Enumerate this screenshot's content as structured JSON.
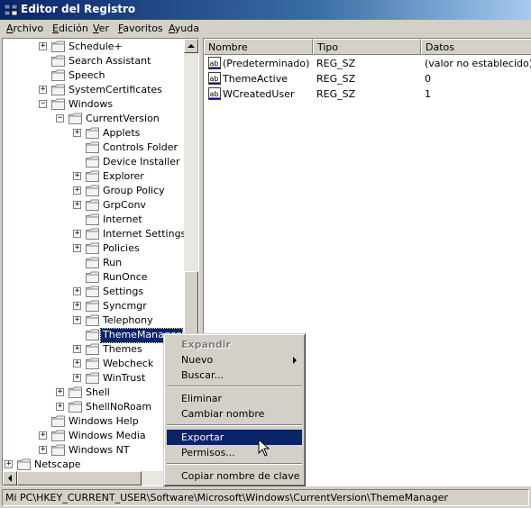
{
  "window": {
    "title": "Editor del Registro"
  },
  "menu": [
    "Archivo",
    "Edición",
    "Ver",
    "Favoritos",
    "Ayuda"
  ],
  "tree": [
    {
      "label": "Schedule+",
      "expander": "+"
    },
    {
      "label": "Search Assistant",
      "expander": ""
    },
    {
      "label": "Speech",
      "expander": ""
    },
    {
      "label": "SystemCertificates",
      "expander": "+"
    },
    {
      "label": "Windows",
      "expander": "−"
    },
    {
      "label": "CurrentVersion",
      "expander": "−"
    },
    {
      "label": "Applets",
      "expander": "+"
    },
    {
      "label": "Controls Folder",
      "expander": ""
    },
    {
      "label": "Device Installer",
      "expander": ""
    },
    {
      "label": "Explorer",
      "expander": "+"
    },
    {
      "label": "Group Policy",
      "expander": "+"
    },
    {
      "label": "GrpConv",
      "expander": "+"
    },
    {
      "label": "Internet",
      "expander": ""
    },
    {
      "label": "Internet Settings",
      "expander": "+"
    },
    {
      "label": "Policies",
      "expander": "+"
    },
    {
      "label": "Run",
      "expander": ""
    },
    {
      "label": "RunOnce",
      "expander": ""
    },
    {
      "label": "Settings",
      "expander": "+"
    },
    {
      "label": "Syncmgr",
      "expander": "+"
    },
    {
      "label": "Telephony",
      "expander": "+"
    },
    {
      "label": "ThemeManager",
      "expander": "",
      "selected": true
    },
    {
      "label": "Themes",
      "expander": "+"
    },
    {
      "label": "Webcheck",
      "expander": "+"
    },
    {
      "label": "WinTrust",
      "expander": "+"
    },
    {
      "label": "Shell",
      "expander": "+"
    },
    {
      "label": "ShellNoRoam",
      "expander": "+"
    },
    {
      "label": "Windows Help",
      "expander": ""
    },
    {
      "label": "Windows Media",
      "expander": "+"
    },
    {
      "label": "Windows NT",
      "expander": "+"
    },
    {
      "label": "Netscape",
      "expander": "+"
    }
  ],
  "list": {
    "columns": [
      "Nombre",
      "Tipo",
      "Datos"
    ],
    "rows": [
      {
        "name": "(Predeterminado)",
        "type": "REG_SZ",
        "data": "(valor no establecido)"
      },
      {
        "name": "ThemeActive",
        "type": "REG_SZ",
        "data": "0"
      },
      {
        "name": "WCreatedUser",
        "type": "REG_SZ",
        "data": "1"
      }
    ]
  },
  "context_menu": {
    "items": [
      {
        "label": "Expandir",
        "disabled": true
      },
      {
        "label": "Nuevo",
        "submenu": true
      },
      {
        "label": "Buscar..."
      },
      {
        "sep": true
      },
      {
        "label": "Eliminar"
      },
      {
        "label": "Cambiar nombre"
      },
      {
        "sep": true
      },
      {
        "label": "Exportar",
        "highlighted": true
      },
      {
        "label": "Permisos..."
      },
      {
        "sep": true
      },
      {
        "label": "Copiar nombre de clave"
      }
    ]
  },
  "status": "Mi PC\\HKEY_CURRENT_USER\\Software\\Microsoft\\Windows\\CurrentVersion\\ThemeManager",
  "colors": {
    "selection": "#0a246a",
    "face": "#d4d0c8",
    "folder": "#f3f3f3"
  },
  "icons": [
    "regedit-icon",
    "folder-icon",
    "string-value-icon",
    "mouse-cursor-icon"
  ]
}
